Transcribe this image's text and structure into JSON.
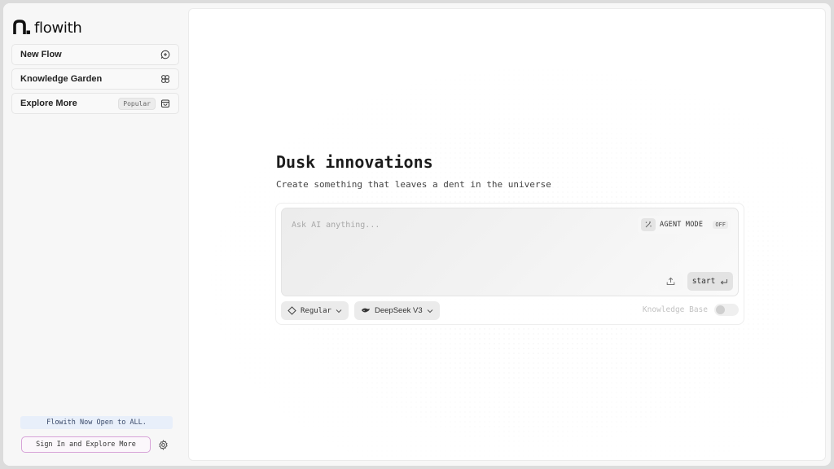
{
  "brand": {
    "name": "flowith"
  },
  "sidebar": {
    "items": [
      {
        "label": "New Flow",
        "icon": "new-chat-icon"
      },
      {
        "label": "Knowledge Garden",
        "icon": "garden-icon"
      },
      {
        "label": "Explore More",
        "badge": "Popular",
        "icon": "shopping-bag-icon"
      }
    ],
    "announcement": "Flowith Now Open to ALL.",
    "signin_label": "Sign In and Explore More",
    "settings_icon": "gear-icon"
  },
  "main": {
    "title": "Dusk innovations",
    "subtitle": "Create something that leaves a dent in the universe",
    "composer": {
      "placeholder": "Ask AI anything...",
      "agent_mode_label": "AGENT MODE",
      "agent_mode_state": "OFF",
      "start_label": "start",
      "mode_label": "Regular",
      "model_label": "DeepSeek V3",
      "knowledge_base_label": "Knowledge Base",
      "knowledge_base_enabled": false
    }
  },
  "colors": {
    "accent_signin_border": "#d7a3d8",
    "announcement_bg": "#e8effa"
  }
}
